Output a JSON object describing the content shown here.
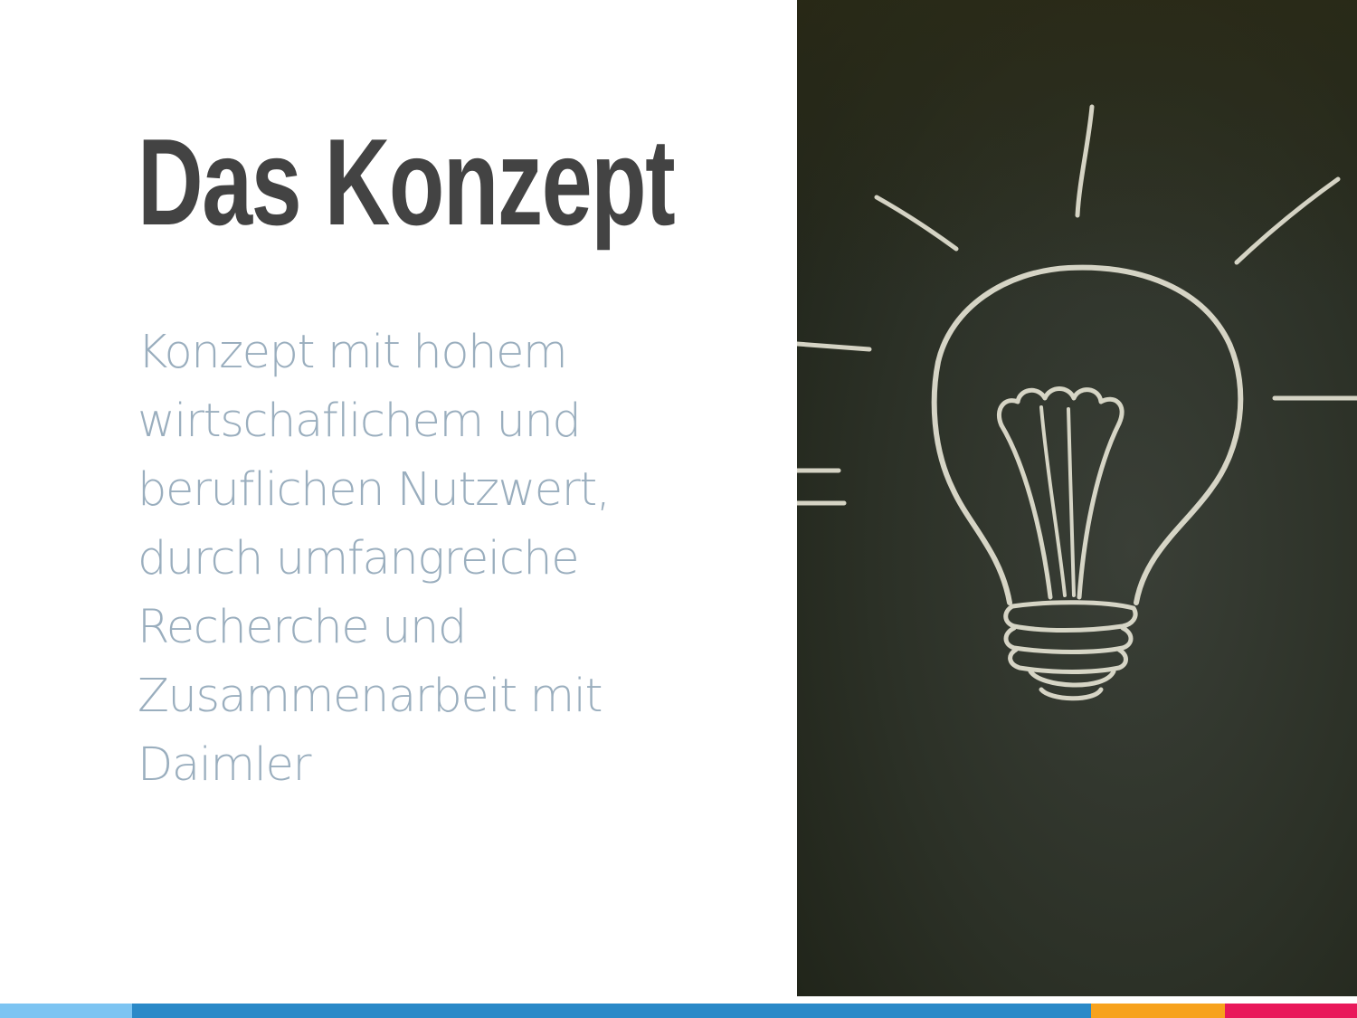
{
  "slide": {
    "title": "Das Konzept",
    "body": "Konzept mit hohem\nwirtschaflichem und\nberuflichen Nutzwert,\ndurch umfangreiche\nRecherche und\nZusammenarbeit mit\nDaimler"
  },
  "image": {
    "subject": "lightbulb-chalk-drawing",
    "colors": {
      "chalkboard": "#2b2f22",
      "chalk": "#e8e6d6"
    }
  },
  "bottom_bar": {
    "segments": [
      {
        "name": "light-blue",
        "color": "#7cc4f2"
      },
      {
        "name": "blue",
        "color": "#2a89c8"
      },
      {
        "name": "orange",
        "color": "#f7a21d"
      },
      {
        "name": "pink",
        "color": "#e9185a"
      }
    ]
  },
  "colors": {
    "title": "#434343",
    "body": "#9aaebe",
    "background": "#ffffff"
  }
}
